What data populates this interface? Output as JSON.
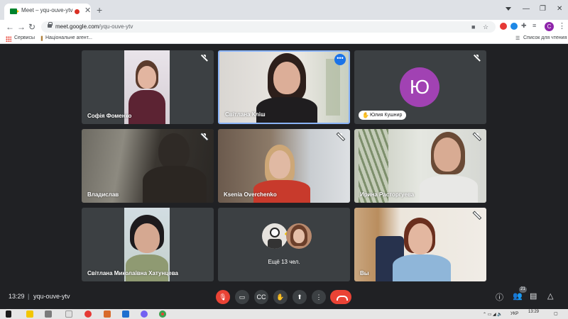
{
  "browser": {
    "tab_title": "Meet – yqu-ouve-ytv",
    "tab_close": "✕",
    "new_tab": "+",
    "url_host": "meet.google.com",
    "url_path": "/yqu-ouve-ytv",
    "profile_initial": "C",
    "bookmarks": [
      "Сервисы",
      "Національне агент..."
    ],
    "reading_list": "Список для чтения"
  },
  "participants": [
    {
      "name": "Софія Фоменко",
      "muted": true
    },
    {
      "name": "Світлана Кліш",
      "muted": false,
      "active_speaker": true
    },
    {
      "name": "Юлия Кушнир",
      "muted": true,
      "avatar_letter": "Ю",
      "avatar_color": "#a142b3",
      "hand_raised": true
    },
    {
      "name": "Владислав",
      "muted": true
    },
    {
      "name": "Ksenia Overchenko",
      "muted": true
    },
    {
      "name": "Ирина Расторгуева",
      "muted": true
    },
    {
      "name": "Світлана Миколаївна Хатунцева",
      "muted": false
    },
    {
      "name": "Ещё 13 чел.",
      "muted": false
    },
    {
      "name": "Вы",
      "muted": true
    }
  ],
  "bottom_bar": {
    "time": "13:29",
    "separator": "|",
    "meeting_code": "yqu-ouve-ytv",
    "people_count": "21"
  },
  "taskbar": {
    "lang": "УКР",
    "time": "13:29"
  },
  "colors": {
    "background": "#202124",
    "tile": "#3c4043",
    "accent": "#8ab4f8",
    "end_call": "#ea4335"
  }
}
